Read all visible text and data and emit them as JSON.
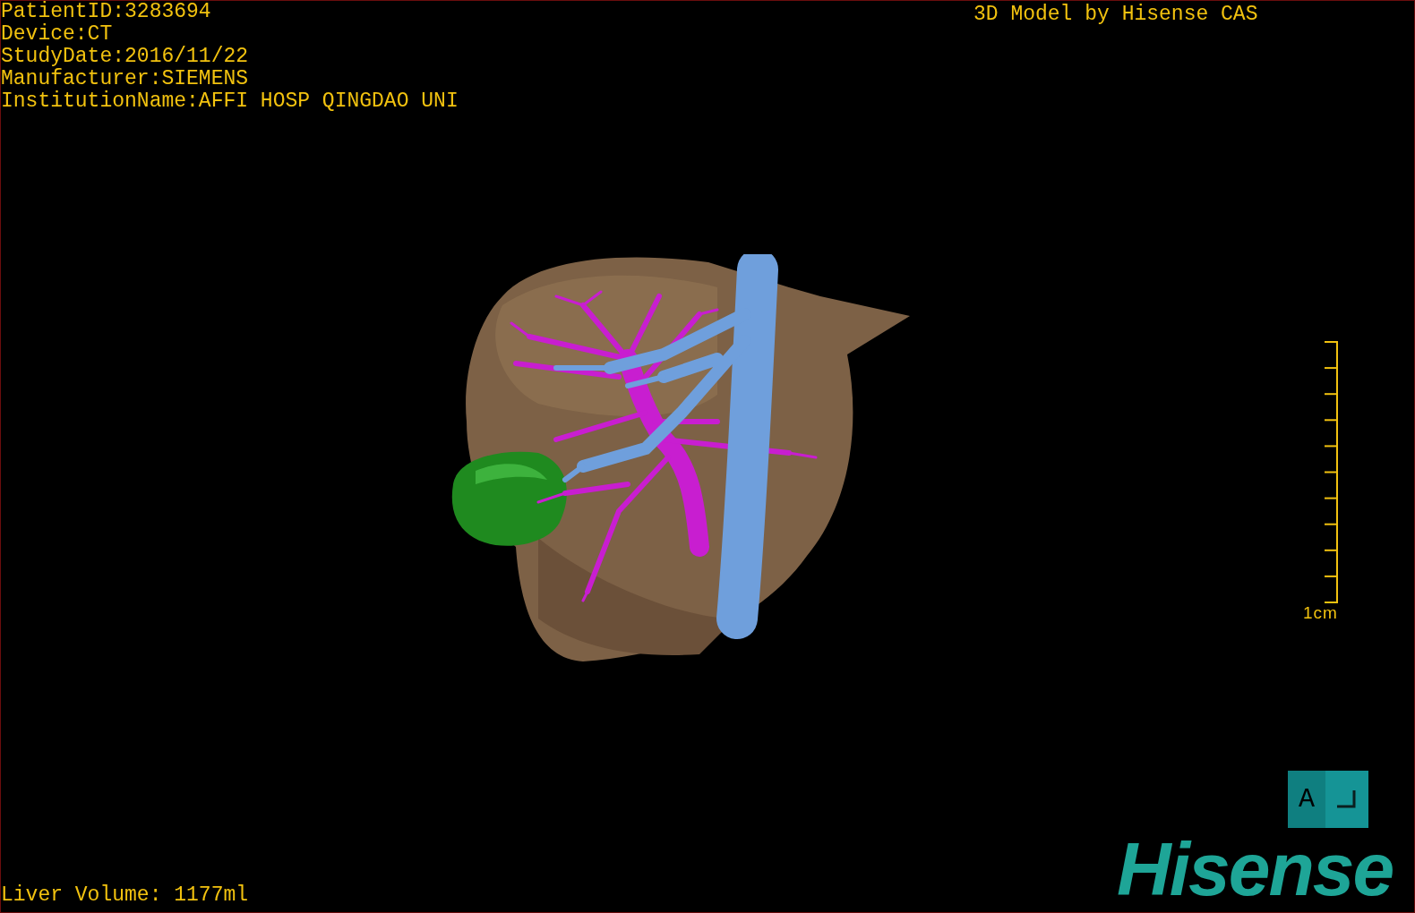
{
  "study_info": [
    "PatientID:3283694",
    "Device:CT",
    "StudyDate:2016/11/22",
    "Manufacturer:SIEMENS",
    "InstitutionName:AFFI HOSP QINGDAO UNI"
  ],
  "model_credit": "3D Model by Hisense CAS",
  "scale_bar": {
    "label": "1cm"
  },
  "orientation_cube": {
    "face_label": "A"
  },
  "liver_volume": "Liver Volume: 1177ml",
  "logo": "Hisense"
}
